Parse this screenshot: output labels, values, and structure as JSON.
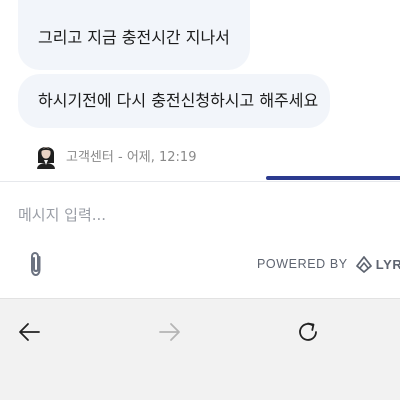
{
  "chat": {
    "messages": [
      {
        "text": "그리고 지금 충전시간 지나서"
      },
      {
        "text": "하시기전에 다시 충전신청하시고 해주세요"
      }
    ],
    "meta": {
      "sender": "고객센터",
      "separator": " - ",
      "time": "어제, 12:19"
    }
  },
  "composer": {
    "placeholder": "메시지 입력...",
    "attach_icon": "paperclip-icon"
  },
  "branding": {
    "powered_by": "POWERED BY",
    "brand": "LYRO",
    "logo_icon": "lyro-logo-icon"
  },
  "browser_toolbar": {
    "back_icon": "arrow-left-icon",
    "forward_icon": "arrow-right-icon",
    "reload_icon": "reload-icon"
  },
  "colors": {
    "bubble_bg": "#f2f5fa",
    "accent": "#2b3a8f",
    "toolbar_bg": "#f2f2f2"
  }
}
